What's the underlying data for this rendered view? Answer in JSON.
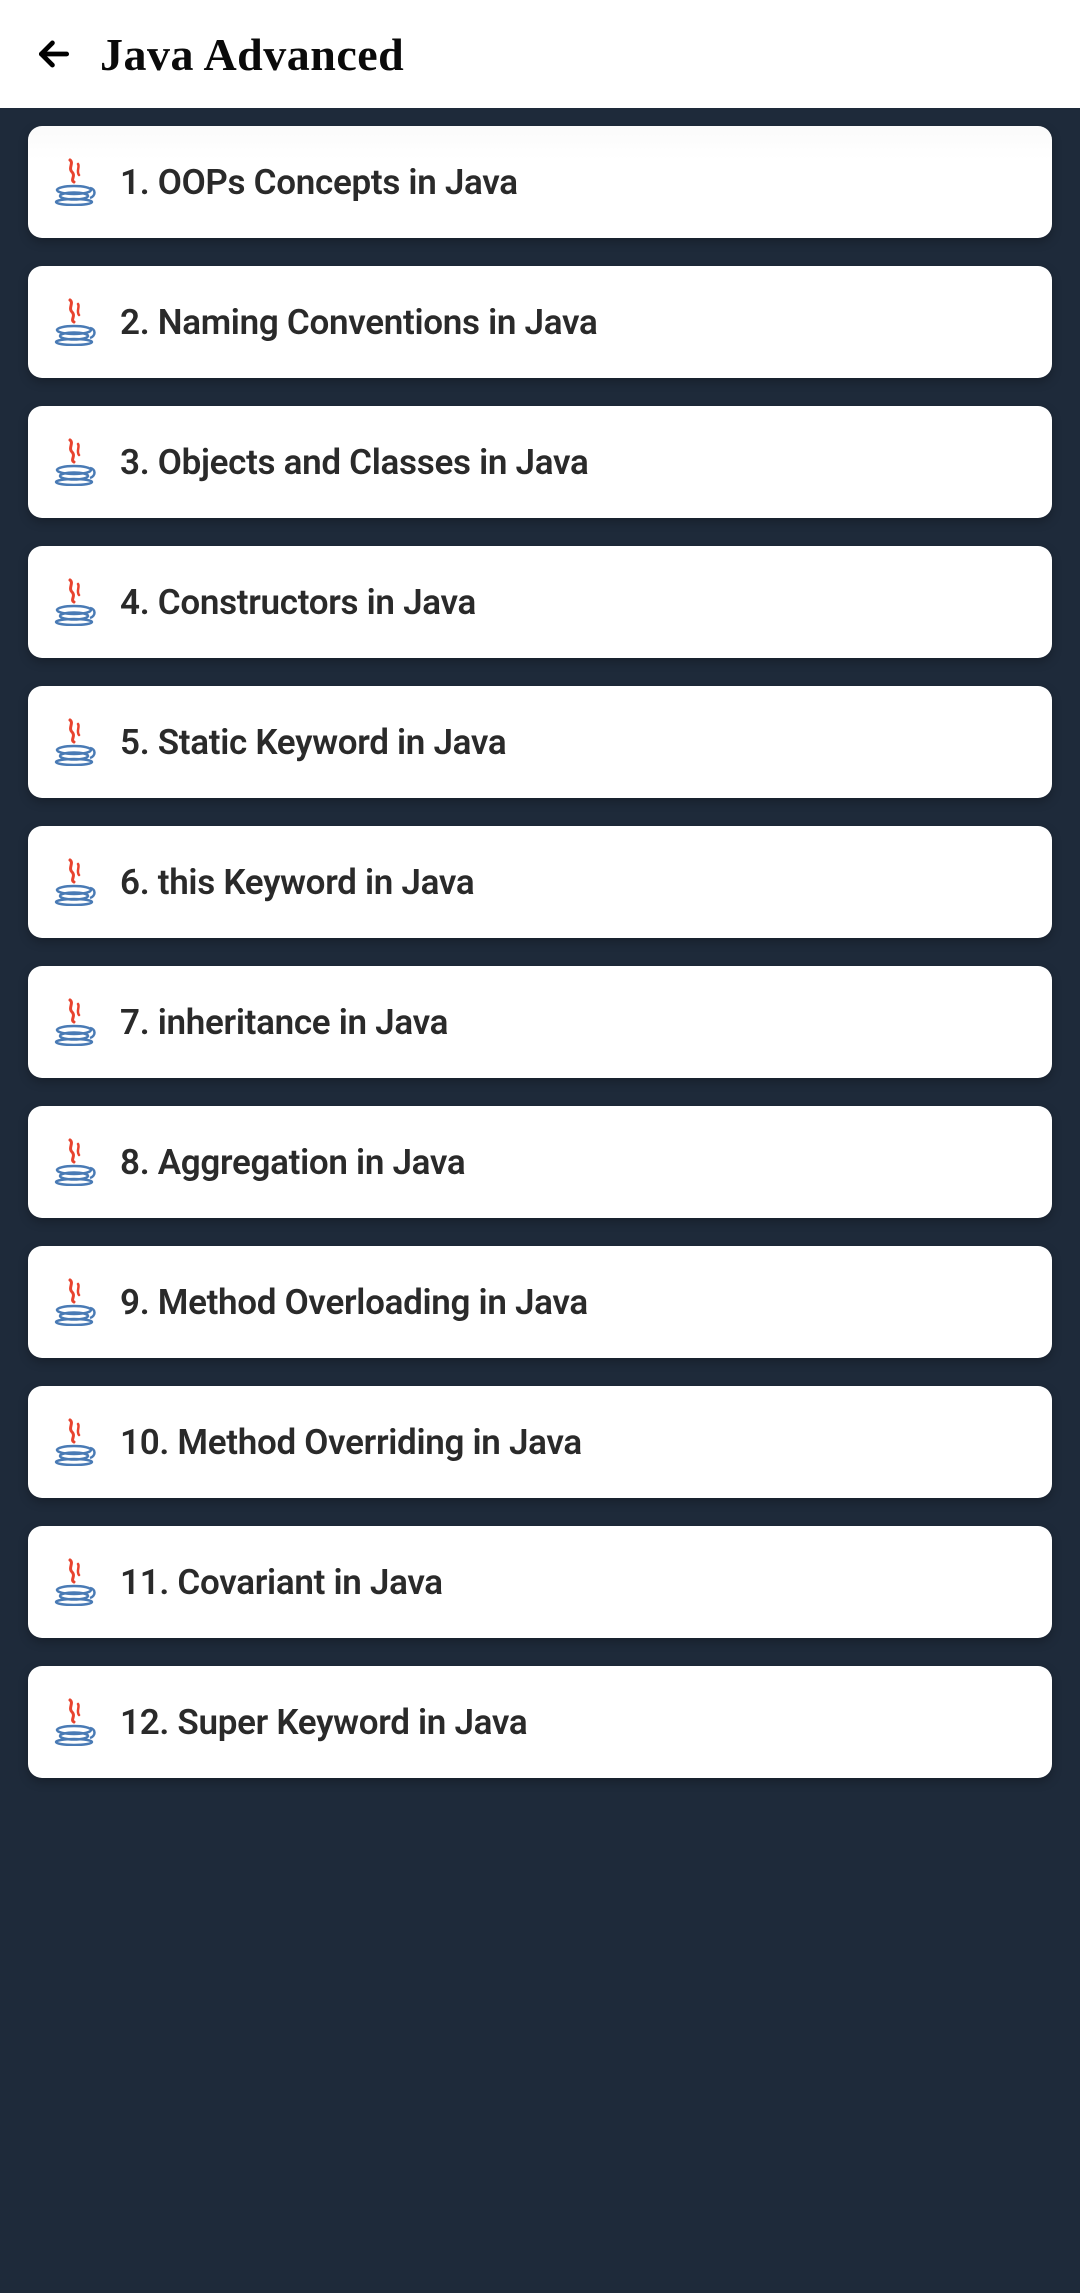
{
  "header": {
    "title": "Java Advanced"
  },
  "items": [
    {
      "label": "1. OOPs Concepts in Java"
    },
    {
      "label": "2. Naming Conventions in Java"
    },
    {
      "label": "3. Objects and Classes in Java"
    },
    {
      "label": "4. Constructors in Java"
    },
    {
      "label": "5. Static Keyword in Java"
    },
    {
      "label": "6. this Keyword in Java"
    },
    {
      "label": "7. inheritance in Java"
    },
    {
      "label": "8. Aggregation in Java"
    },
    {
      "label": "9. Method Overloading in Java"
    },
    {
      "label": "10. Method Overriding in Java"
    },
    {
      "label": "11. Covariant in Java"
    },
    {
      "label": "12. Super Keyword in Java"
    }
  ]
}
